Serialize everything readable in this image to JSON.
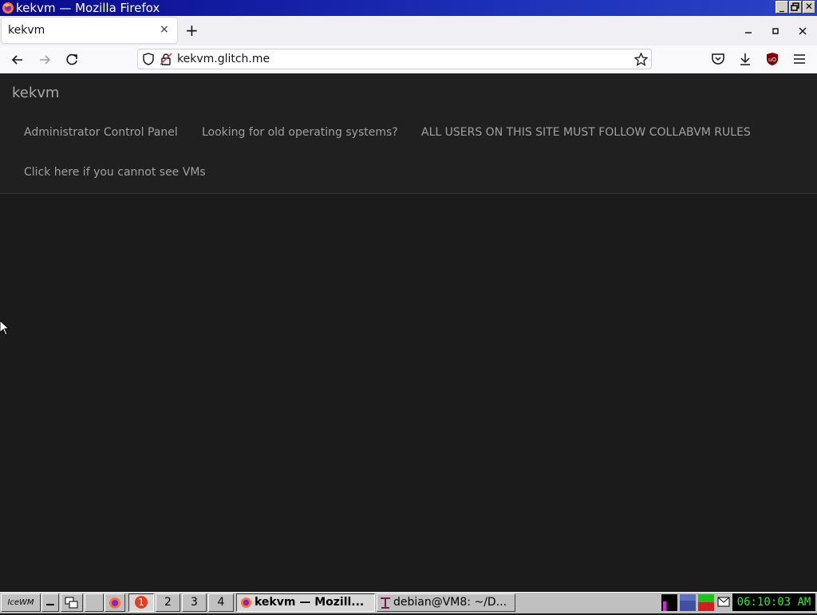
{
  "window": {
    "title": "kekvm — Mozilla Firefox"
  },
  "browser": {
    "tab_label": "kekvm",
    "url": "kekvm.glitch.me",
    "new_tab_symbol": "+",
    "tab_close_symbol": "×"
  },
  "page": {
    "brand": "kekvm",
    "nav": [
      {
        "label": "Administrator Control Panel"
      },
      {
        "label": "Looking for old operating systems?"
      },
      {
        "label": "ALL USERS ON THIS SITE MUST FOLLOW COLLABVM RULES"
      },
      {
        "label": "Click here if you cannot see VMs"
      }
    ]
  },
  "taskbar": {
    "start_label": "IceWM",
    "workspaces": [
      "1",
      "2",
      "3",
      "4"
    ],
    "tasks": [
      {
        "label": "kekvm — Mozill...",
        "icon": "firefox-icon",
        "active": true
      },
      {
        "label": "debian@VM8: ~/D...",
        "icon": "terminal-icon",
        "active": false
      }
    ],
    "clock": "06:10:03 AM"
  },
  "icons": {
    "back": "back-arrow-icon",
    "forward": "forward-arrow-icon",
    "reload": "reload-icon",
    "shield": "tracking-protection-icon",
    "lock": "insecure-lock-icon",
    "bookmark": "star-icon",
    "pocket": "pocket-icon",
    "downloads": "download-icon",
    "ublock": "ublock-origin-icon",
    "menu": "hamburger-menu-icon"
  },
  "colors": {
    "page_bg": "#1b1b1b",
    "header_bg": "#202020",
    "nav_text": "#a0a0a0",
    "clock_text": "#2ee82e",
    "titlebar": "#0a0a8c"
  }
}
